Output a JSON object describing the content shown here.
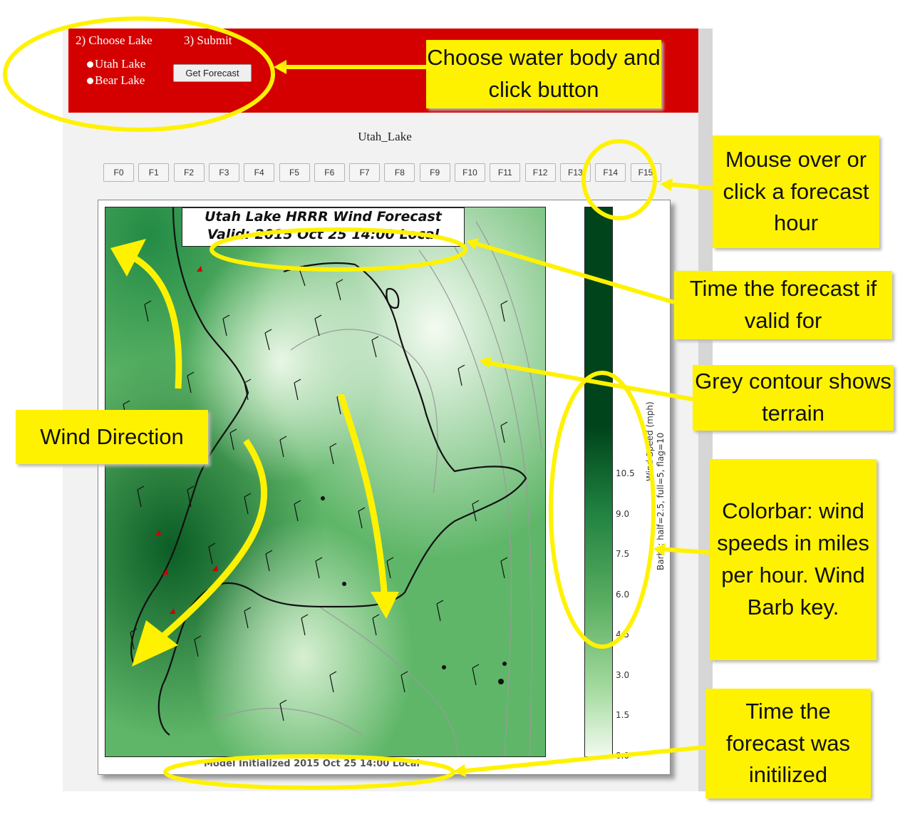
{
  "controls": {
    "step2_label": "2) Choose Lake",
    "step3_label": "3) Submit",
    "lake_options": [
      "Utah Lake",
      "Bear Lake"
    ],
    "submit_label": "Get Forecast"
  },
  "lake_title": "Utah_Lake",
  "forecast_hours": [
    "F0",
    "F1",
    "F2",
    "F3",
    "F4",
    "F5",
    "F6",
    "F7",
    "F8",
    "F9",
    "F10",
    "F11",
    "F12",
    "F13",
    "F14",
    "F15"
  ],
  "map": {
    "title_line1": "Utah Lake HRRR Wind Forecast",
    "title_line2": "Valid: 2015 Oct 25 14:00 Local",
    "init_text": "Model Initialized 2015 Oct 25 14:00 Local"
  },
  "colorbar": {
    "ticks": [
      "10.5",
      "9.0",
      "7.5",
      "6.0",
      "4.5",
      "3.0",
      "1.5",
      "0.0"
    ],
    "label": "Wind Speed (mph)",
    "barb_key": "Barbs: half=2.5, full=5, flag=10",
    "colors": {
      "low": "#f2faf0",
      "mid": "#74c476",
      "high": "#00441b"
    }
  },
  "annotations": {
    "choose": "Choose water body and click button",
    "mouse_over": "Mouse over or click a forecast hour",
    "valid_time": "Time the forecast if valid for",
    "terrain": "Grey contour shows terrain",
    "wind_direction": "Wind Direction",
    "colorbar": "Colorbar: wind speeds in miles per hour. Wind Barb key.",
    "init_time": "Time the forecast was initilized",
    "highlight_color": "#fff200"
  }
}
